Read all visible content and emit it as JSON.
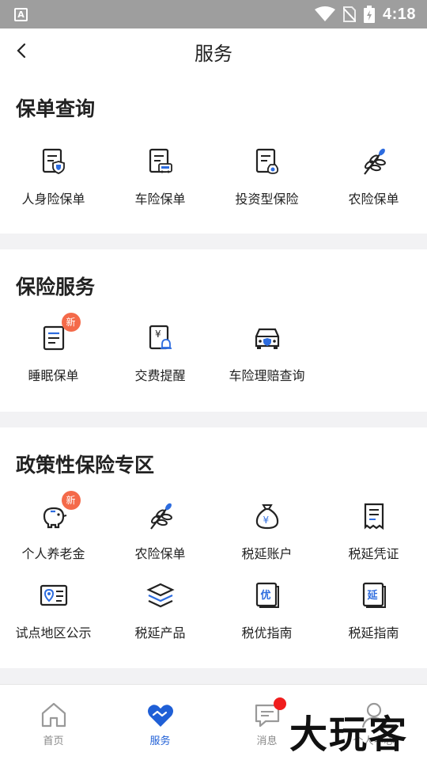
{
  "status_bar": {
    "time": "4:18",
    "app_indicator": "A"
  },
  "header": {
    "title": "服务",
    "back_icon": "chevron-left-icon"
  },
  "sections": {
    "policy_query": {
      "title": "保单查询",
      "items": [
        {
          "label": "人身险保单",
          "icon": "doc-shield-icon"
        },
        {
          "label": "车险保单",
          "icon": "doc-car-icon"
        },
        {
          "label": "投资型保险",
          "icon": "doc-moneybag-icon"
        },
        {
          "label": "农险保单",
          "icon": "wheat-icon"
        }
      ]
    },
    "insurance_service": {
      "title": "保险服务",
      "items": [
        {
          "label": "睡眠保单",
          "icon": "doc-icon",
          "badge": "新"
        },
        {
          "label": "交费提醒",
          "icon": "yen-bell-icon"
        },
        {
          "label": "车险理赔查询",
          "icon": "car-shield-icon"
        }
      ]
    },
    "policy_zone": {
      "title": "政策性保险专区",
      "items": [
        {
          "label": "个人养老金",
          "icon": "piggy-bank-icon",
          "badge": "新"
        },
        {
          "label": "农险保单",
          "icon": "wheat-icon"
        },
        {
          "label": "税延账户",
          "icon": "yen-bag-icon"
        },
        {
          "label": "税延凭证",
          "icon": "receipt-icon"
        },
        {
          "label": "试点地区公示",
          "icon": "location-card-icon"
        },
        {
          "label": "税延产品",
          "icon": "layers-icon"
        },
        {
          "label": "税优指南",
          "icon": "book-you-icon",
          "book_char": "优"
        },
        {
          "label": "税延指南",
          "icon": "book-yan-icon",
          "book_char": "延"
        }
      ]
    }
  },
  "bottom_nav": {
    "items": [
      {
        "label": "首页",
        "icon": "home-icon"
      },
      {
        "label": "服务",
        "icon": "handshake-heart-icon",
        "active": true
      },
      {
        "label": "消息",
        "icon": "message-icon",
        "unread_dot": true
      },
      {
        "label": "个人中心",
        "icon": "person-icon"
      }
    ]
  },
  "watermark": "大玩客",
  "colors": {
    "accent": "#1f5fd6",
    "badge": "#f46a4a",
    "dot": "#f01d1d",
    "divider": "#f2f2f4",
    "statusbar": "#9e9e9e"
  }
}
